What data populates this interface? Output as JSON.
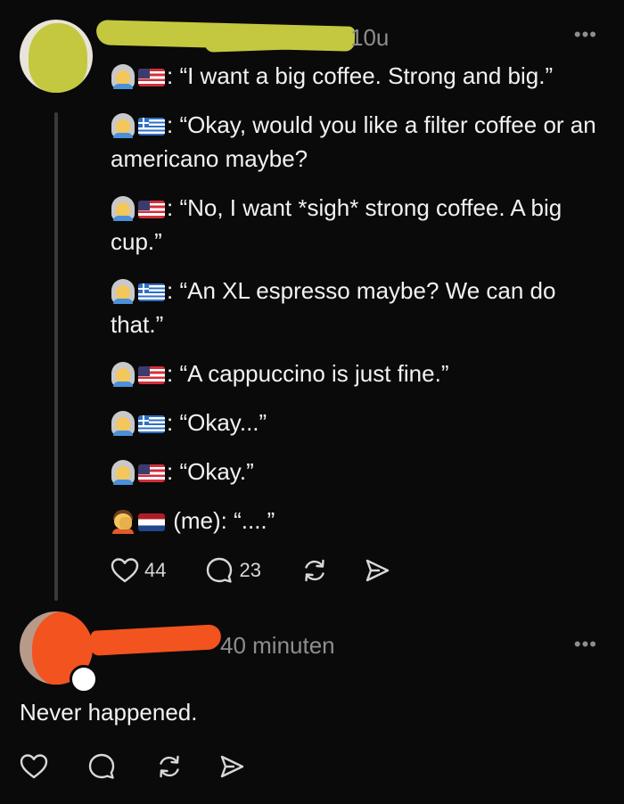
{
  "post": {
    "time": "10u",
    "more_label": "•••",
    "lines": [
      {
        "speaker": "woman-us",
        "text": ": “I want a big coffee. Strong and big.”"
      },
      {
        "speaker": "woman-gr",
        "text": ": “Okay, would you like a filter coffee or an americano maybe?"
      },
      {
        "speaker": "woman-us",
        "text": ": “No, I want *sigh* strong coffee. A big cup.”"
      },
      {
        "speaker": "woman-gr",
        "text": ": “An XL espresso maybe? We can do that.”"
      },
      {
        "speaker": "woman-us",
        "text": ": “A cappuccino is just fine.”"
      },
      {
        "speaker": "woman-gr",
        "text": ": “Okay...”"
      },
      {
        "speaker": "woman-us",
        "text": ": “Okay.”"
      },
      {
        "speaker": "facepalm-nl",
        "text": " (me): “....”"
      }
    ],
    "likes": "44",
    "comments": "23"
  },
  "reply": {
    "time": "40 minuten",
    "more_label": "•••",
    "text": "Never happened."
  },
  "colors": {
    "background": "#0a0a0a",
    "text": "#f2f2f2",
    "muted": "#8e8e8e",
    "redact_yellow": "#c4c83e",
    "redact_orange": "#f2531f"
  },
  "icons": {
    "like": "heart-icon",
    "comment": "comment-bubble-icon",
    "repost": "repost-icon",
    "share": "send-icon"
  }
}
